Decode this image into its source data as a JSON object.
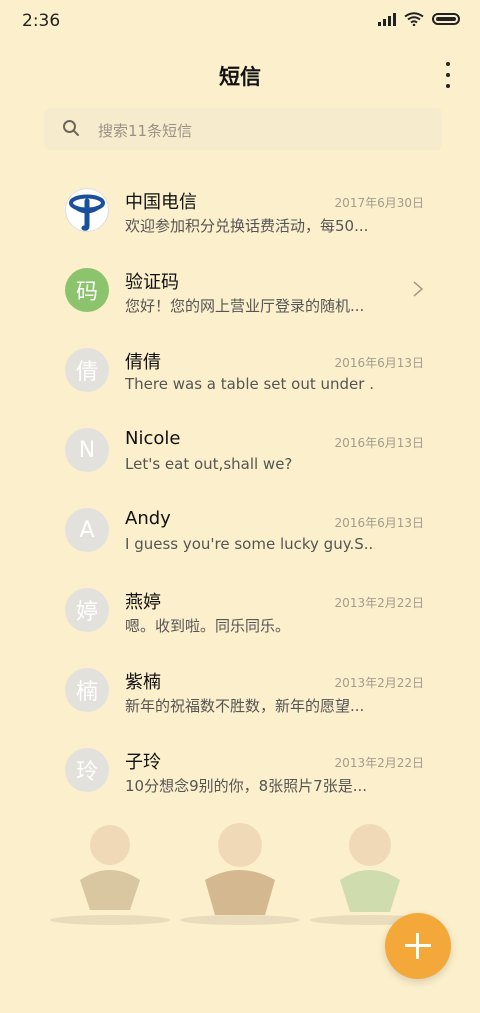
{
  "status": {
    "time": "2:36"
  },
  "header": {
    "title": "短信"
  },
  "search": {
    "placeholder": "搜索11条短信"
  },
  "conversations": [
    {
      "avatar": "",
      "avatar_style": "telecom",
      "name": "中国电信",
      "preview": "欢迎参加积分兑换话费活动，每50...",
      "date": "2017年6月30日"
    },
    {
      "avatar": "码",
      "avatar_style": "green",
      "name": "验证码",
      "preview": "您好！您的网上营业厅登录的随机...",
      "date": ""
    },
    {
      "avatar": "倩",
      "avatar_style": "gray",
      "name": "倩倩",
      "preview": "There was a table set out under ...",
      "date": "2016年6月13日"
    },
    {
      "avatar": "N",
      "avatar_style": "gray",
      "name": "Nicole",
      "preview": "Let's eat out,shall we?",
      "date": "2016年6月13日"
    },
    {
      "avatar": "A",
      "avatar_style": "gray",
      "name": "Andy",
      "preview": "I guess you're some lucky guy.S...",
      "date": "2016年6月13日"
    },
    {
      "avatar": "婷",
      "avatar_style": "gray",
      "name": "燕婷",
      "preview": "嗯。收到啦。同乐同乐。",
      "date": "2013年2月22日"
    },
    {
      "avatar": "楠",
      "avatar_style": "gray",
      "name": "紫楠",
      "preview": "新年的祝福数不胜数，新年的愿望...",
      "date": "2013年2月22日"
    },
    {
      "avatar": "玲",
      "avatar_style": "gray",
      "name": "子玲",
      "preview": "10分想念9别的你，8张照片7张是...",
      "date": "2013年2月22日"
    }
  ],
  "colors": {
    "background": "#fcefcb",
    "fab": "#f4a83a",
    "green_avatar": "#8cc46e",
    "telecom_blue": "#1a4f9c"
  }
}
